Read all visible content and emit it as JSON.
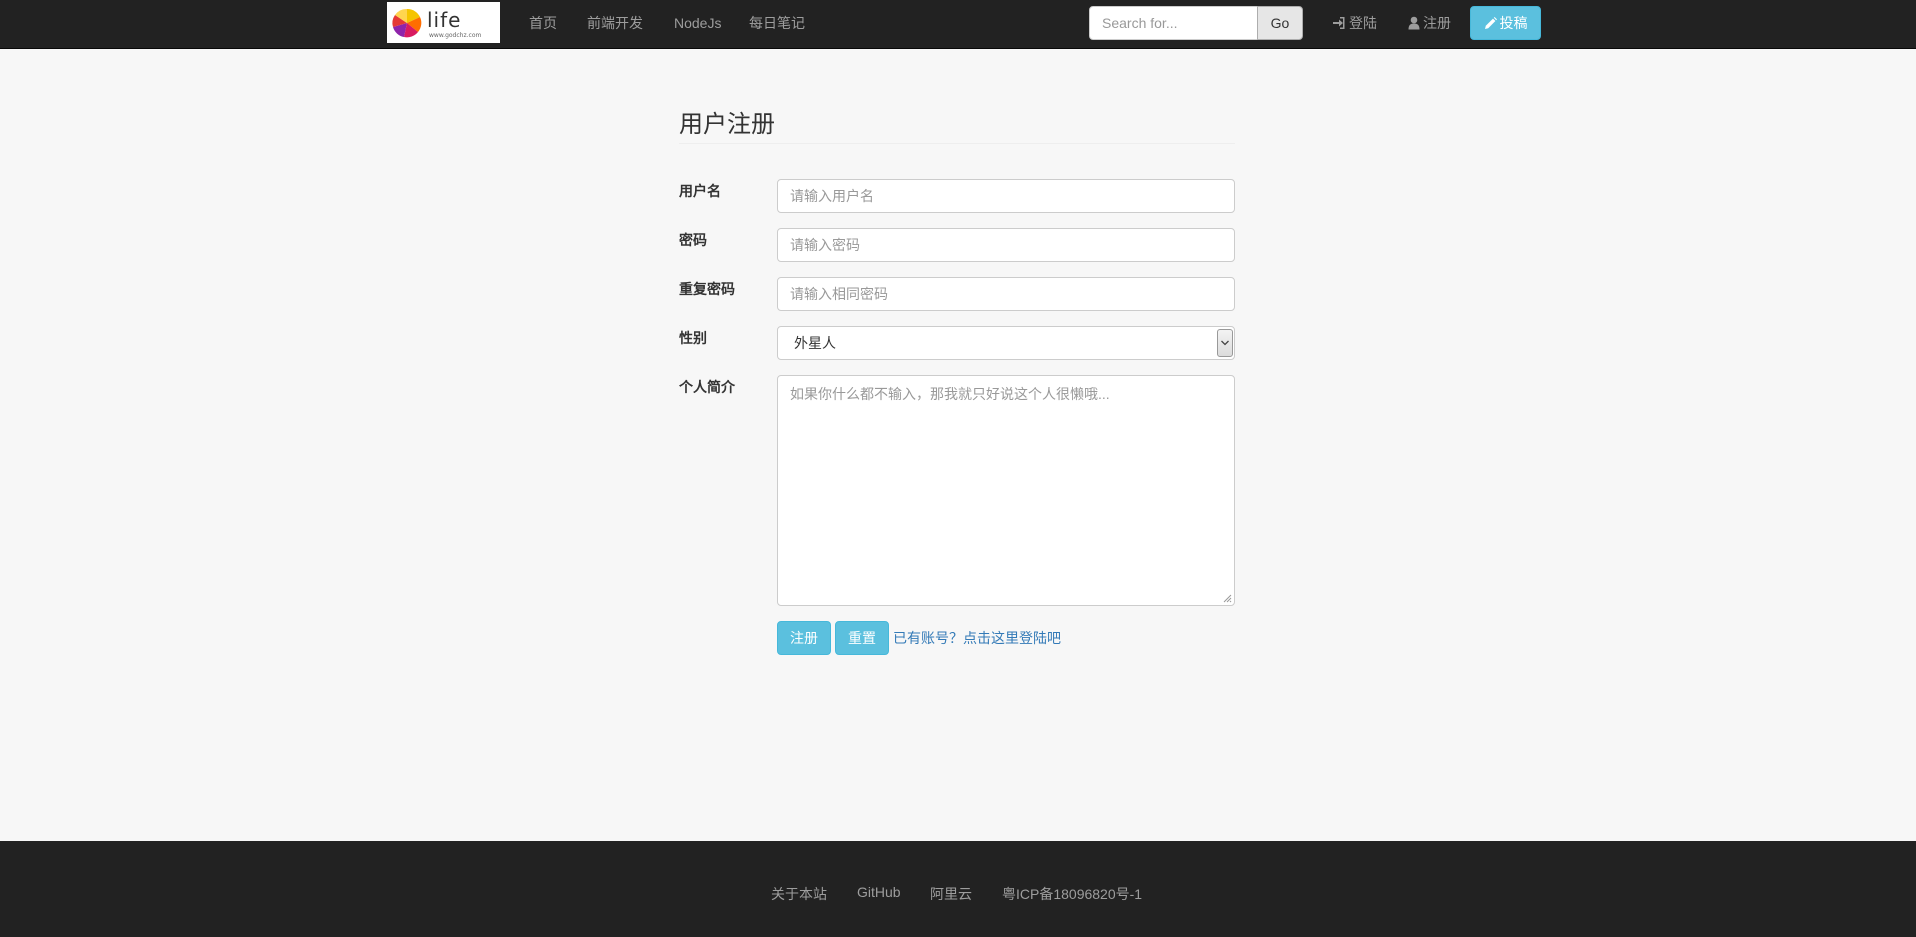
{
  "navbar": {
    "logo": {
      "word": "life",
      "url_text": "www.godchz.com"
    },
    "links": [
      "首页",
      "前端开发",
      "NodeJs",
      "每日笔记"
    ],
    "search": {
      "placeholder": "Search for...",
      "button": "Go"
    },
    "login_label": "登陆",
    "register_label": "注册",
    "post_label": "投稿",
    "icons": {
      "login": "sign-in-icon",
      "register": "user-icon",
      "post": "pencil-icon"
    }
  },
  "form": {
    "title": "用户注册",
    "username": {
      "label": "用户名",
      "placeholder": "请输入用户名"
    },
    "password": {
      "label": "密码",
      "placeholder": "请输入密码"
    },
    "repeat_password": {
      "label": "重复密码",
      "placeholder": "请输入相同密码"
    },
    "gender": {
      "label": "性别",
      "selected": "外星人"
    },
    "bio": {
      "label": "个人简介",
      "placeholder": "如果你什么都不输入，那我就只好说这个人很懒哦..."
    },
    "submit_label": "注册",
    "reset_label": "重置",
    "login_link": "已有账号？点击这里登陆吧"
  },
  "footer": {
    "links": [
      "关于本站",
      "GitHub",
      "阿里云",
      "粤ICP备18096820号-1"
    ]
  },
  "colors": {
    "navbar_bg": "#222222",
    "page_bg": "#f7f7f7",
    "info_button": "#5bc0de",
    "link": "#337ab7"
  }
}
